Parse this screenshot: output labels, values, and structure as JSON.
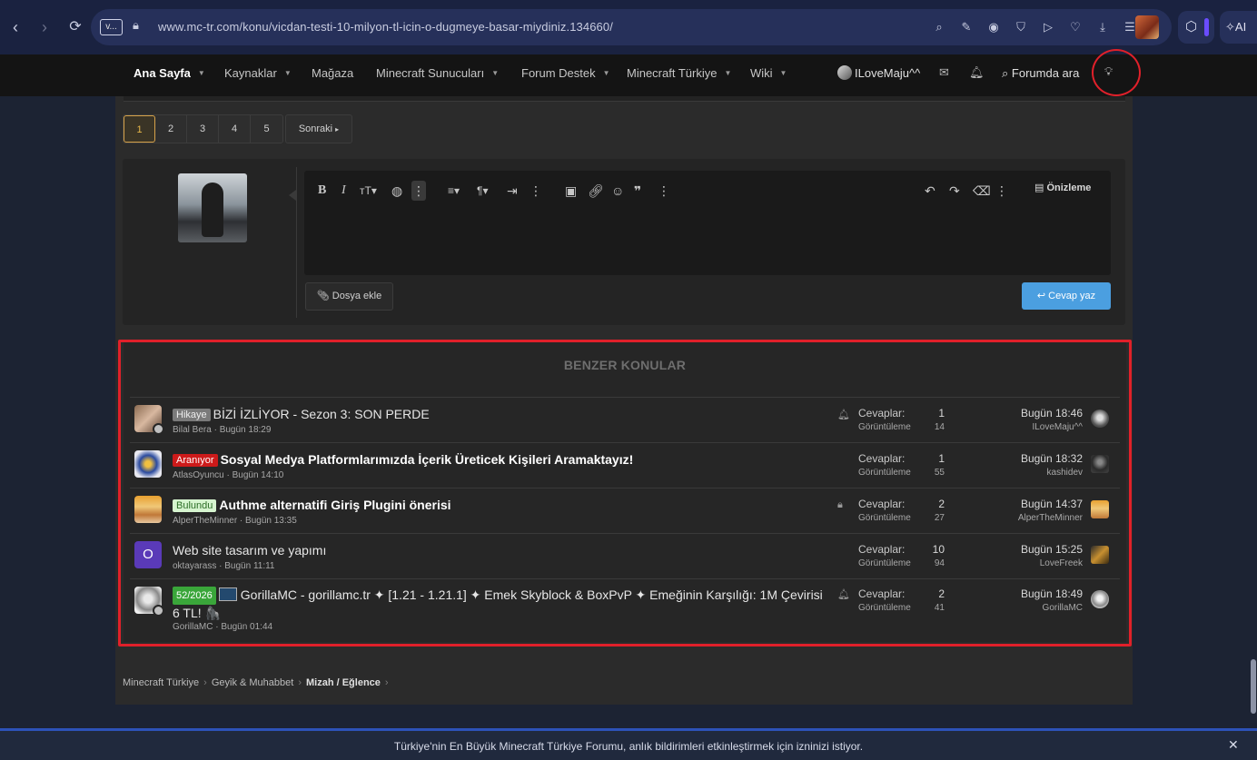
{
  "browser": {
    "tab_icon": "v...",
    "url": "www.mc-tr.com/konu/vicdan-testi-10-milyon-tl-icin-o-dugmeye-basar-miydiniz.134660/",
    "ai_label": "AI"
  },
  "header": {
    "nav": [
      {
        "label": "Ana Sayfa"
      },
      {
        "label": "Kaynaklar"
      },
      {
        "label": "Mağaza"
      },
      {
        "label": "Minecraft Sunucuları"
      },
      {
        "label": "Forum Destek"
      },
      {
        "label": "Minecraft Türkiye"
      },
      {
        "label": "Wiki"
      }
    ],
    "username": "ILoveMaju^^",
    "search_label": "Forumda ara"
  },
  "pagination": {
    "pages": [
      "1",
      "2",
      "3",
      "4",
      "5"
    ],
    "current": "1",
    "next_label": "Sonraki"
  },
  "reply": {
    "preview_label": "Önizleme",
    "attach_label": "Dosya ekle",
    "submit_label": "Cevap yaz"
  },
  "similar": {
    "title": "BENZER KONULAR",
    "replies_label": "Cevaplar:",
    "views_label": "Görüntüleme",
    "threads": [
      {
        "prefix": "Hikaye",
        "title": "BİZİ İZLİYOR - Sezon 3: SON PERDE",
        "author": "Bilal Bera",
        "date": "Bugün 18:29",
        "replies": "1",
        "views": "14",
        "last_date": "Bugün 18:46",
        "last_user": "ILoveMaju^^",
        "status_icon": "bell-icon"
      },
      {
        "prefix": "Aranıyor",
        "title": "Sosyal Medya Platformlarımızda İçerik Üreticek Kişileri Aramaktayız!",
        "author": "AtlasOyuncu",
        "date": "Bugün 14:10",
        "replies": "1",
        "views": "55",
        "last_date": "Bugün 18:32",
        "last_user": "kashidev"
      },
      {
        "prefix": "Bulundu",
        "title": "Authme alternatifi Giriş Plugini önerisi",
        "author": "AlperTheMinner",
        "date": "Bugün 13:35",
        "replies": "2",
        "views": "27",
        "last_date": "Bugün 14:37",
        "last_user": "AlperTheMinner",
        "status_icon": "lock-icon"
      },
      {
        "avatar_letter": "O",
        "title": "Web site tasarım ve yapımı",
        "author": "oktayarass",
        "date": "Bugün 11:11",
        "replies": "10",
        "views": "94",
        "last_date": "Bugün 15:25",
        "last_user": "LoveFreek"
      },
      {
        "prefix": "52/2026",
        "title": "GorillaMC - gorillamc.tr ✦ [1.21 - 1.21.1] ✦ Emek Skyblock & BoxPvP ✦ Emeğinin Karşılığı: 1M Çevirisi 6 TL! 🦍",
        "author": "GorillaMC",
        "date": "Bugün 01:44",
        "replies": "2",
        "views": "41",
        "last_date": "Bugün 18:49",
        "last_user": "GorillaMC",
        "status_icon": "bell-icon"
      }
    ]
  },
  "breadcrumb": [
    "Minecraft Türkiye",
    "Geyik & Muhabbet",
    "Mizah / Eğlence"
  ],
  "notification": {
    "text": "Türkiye'nin En Büyük Minecraft Türkiye Forumu, anlık bildirimleri etkinleştirmek için izninizi istiyor."
  },
  "colors": {
    "accent_blue": "#4b9fe0",
    "annotation_red": "#e0202a",
    "prefix_red": "#cc1a1a",
    "prefix_green": "#3aa63a",
    "page_current": "#d6a24a"
  }
}
